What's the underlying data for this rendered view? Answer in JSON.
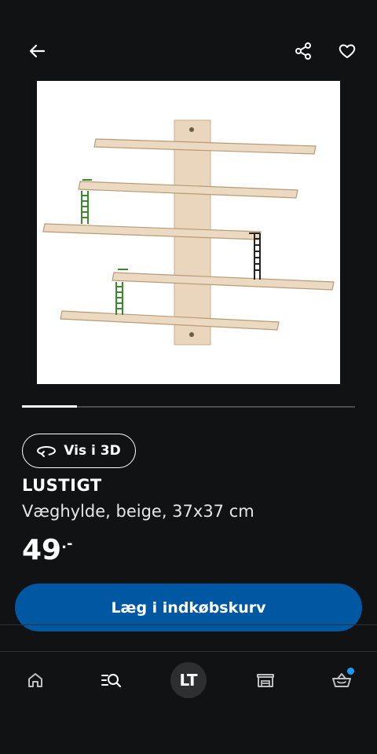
{
  "header": {
    "back_icon": "arrow-left-icon",
    "share_icon": "share-icon",
    "favorite_icon": "heart-icon"
  },
  "product": {
    "name": "LUSTIGT",
    "description": "Væghylde, beige, 37x37 cm",
    "price_main": "49",
    "price_suffix": ".-",
    "image_icon": "wall-shelf-image"
  },
  "carousel": {
    "active_index": 0,
    "total": 6,
    "progress_fraction": 0.166
  },
  "view3d": {
    "label": "Vis i 3D",
    "icon": "rotate-3d-icon"
  },
  "cart_button": {
    "label": "Læg i indkøbskurv"
  },
  "nav": {
    "home_icon": "home-icon",
    "search_icon": "search-list-icon",
    "profile_initials": "LT",
    "store_icon": "store-icon",
    "cart_icon": "basket-icon"
  },
  "colors": {
    "background": "#111213",
    "primary_button": "#0058a3",
    "cart_badge": "#1e9bf0"
  }
}
